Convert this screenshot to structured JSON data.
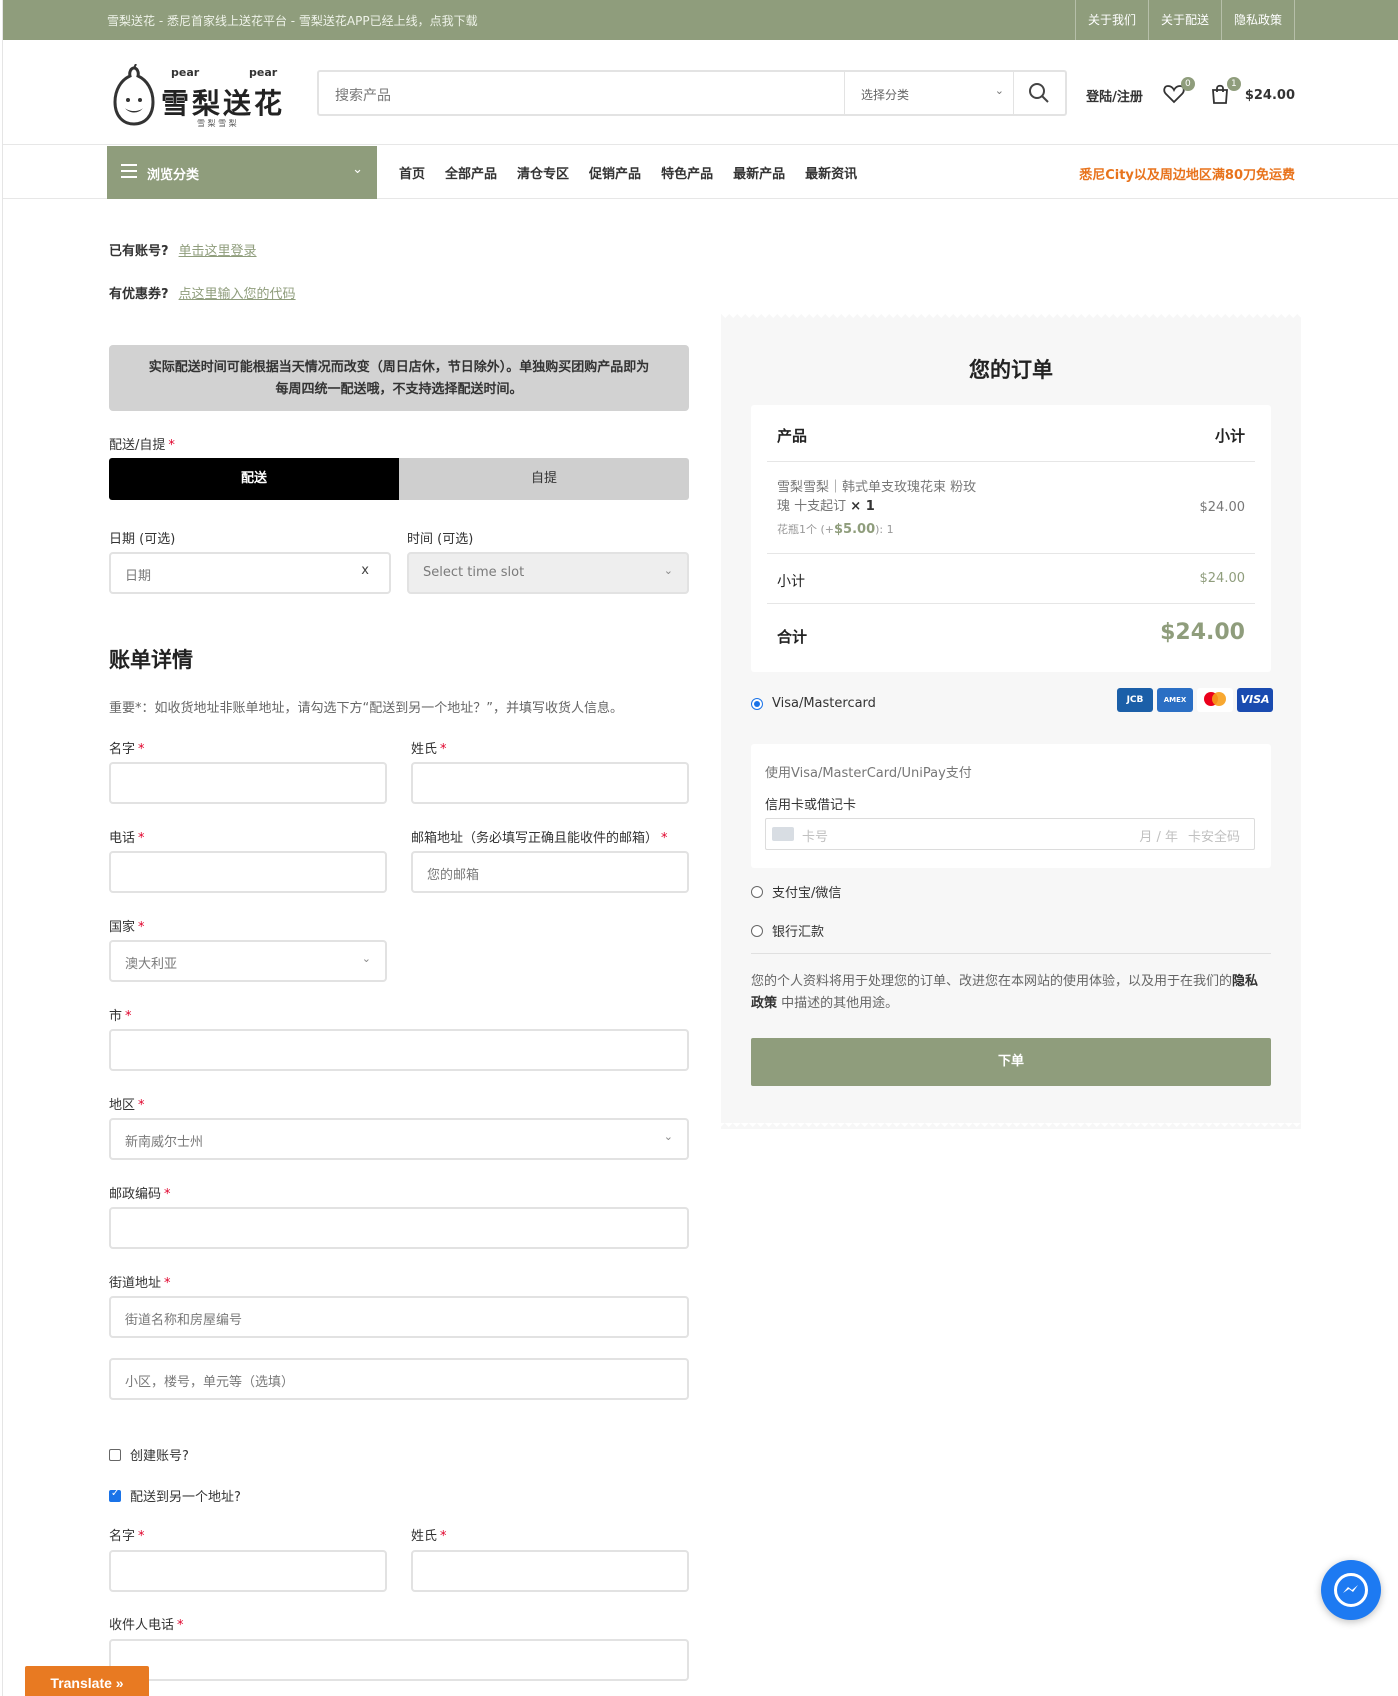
{
  "topbar": {
    "tagline": "雪梨送花 - 悉尼首家线上送花平台 - 雪梨送花APP已经上线，点我下载",
    "links": [
      "关于我们",
      "关于配送",
      "隐私政策"
    ]
  },
  "logo": {
    "top_left": "pear",
    "top_right": "pear",
    "name": "雪梨送花",
    "sub": "雪 梨 雪 梨"
  },
  "search": {
    "placeholder": "搜索产品",
    "category": "选择分类"
  },
  "header": {
    "login": "登陆/注册",
    "wishlist_count": "0",
    "cart_count": "1",
    "cart_total": "$24.00"
  },
  "nav": {
    "browse": "浏览分类",
    "links": [
      "首页",
      "全部产品",
      "清仓专区",
      "促销产品",
      "特色产品",
      "最新产品",
      "最新资讯"
    ],
    "promo": "悉尼City以及周边地区满80刀免运费"
  },
  "notices": {
    "account_q": "已有账号?",
    "account_link": "单击这里登录",
    "coupon_q": "有优惠券?",
    "coupon_link": "点这里输入您的代码"
  },
  "alert": {
    "line1": "实际配送时间可能根据当天情况而改变（周日店休，节日除外）。单独购买团购产品即为",
    "line2": "每周四统一配送哦，不支持选择配送时间。"
  },
  "delivery": {
    "label": "配送/自提",
    "req": "*",
    "options": [
      "配送",
      "自提"
    ],
    "selected": "配送",
    "date_label": "日期 (可选)",
    "date_placeholder": "日期",
    "date_clear": "x",
    "time_label": "时间 (可选)",
    "time_placeholder": "Select time slot"
  },
  "billing": {
    "title": "账单详情",
    "note": "重要*：如收货地址非账单地址，请勾选下方“配送到另一个地址？”，并填写收货人信息。",
    "first_name": "名字",
    "last_name": "姓氏",
    "phone": "电话",
    "email": "邮箱地址（务必填写正确且能收件的邮箱）",
    "email_placeholder": "您的邮箱",
    "country": "国家",
    "country_value": "澳大利亚",
    "city": "市",
    "region": "地区",
    "region_value": "新南威尔士州",
    "postcode": "邮政编码",
    "street": "街道地址",
    "street_placeholder": "街道名称和房屋编号",
    "street2_placeholder": "小区，楼号，单元等（选填）",
    "create_account": "创建账号?",
    "create_account_checked": false,
    "ship_other": "配送到另一个地址?",
    "ship_other_checked": true,
    "ship_first_name": "名字",
    "ship_last_name": "姓氏",
    "ship_phone": "收件人电话"
  },
  "order": {
    "title": "您的订单",
    "col_product": "产品",
    "col_subtotal": "小计",
    "item_line1": "雪梨雪梨｜韩式单支玫瑰花束 粉玫",
    "item_line2": "瑰 十支起订",
    "item_qty": "× 1",
    "item_addon_pre": "花瓶1个 (+",
    "item_addon_price": "$5.00",
    "item_addon_post": "): 1",
    "item_price": "$24.00",
    "subtotal_label": "小计",
    "subtotal_value": "$24.00",
    "total_label": "合计",
    "total_value": "$24.00"
  },
  "payment": {
    "methods": [
      "Visa/Mastercard",
      "支付宝/微信",
      "银行汇款"
    ],
    "selected": "Visa/Mastercard",
    "cards": [
      "JCB",
      "AMEX",
      "MC",
      "VISA"
    ],
    "desc": "使用Visa/MasterCard/UniPay支付",
    "card_label": "信用卡或借记卡",
    "card_number": "卡号",
    "card_exp": "月 / 年",
    "card_cvc": "卡安全码",
    "privacy_pre": "您的个人资料将用于处理您的订单、改进您在本网站的使用体验，以及用于在我们的",
    "privacy_link": "隐私政策",
    "privacy_post": " 中描述的其他用途。",
    "place_order": "下单"
  },
  "colors": {
    "brand": "#8f9d7c",
    "promo": "#e8731c",
    "required": "#e0002a"
  },
  "widgets": {
    "translate": "Translate »",
    "messenger_icon": "messenger-icon"
  }
}
